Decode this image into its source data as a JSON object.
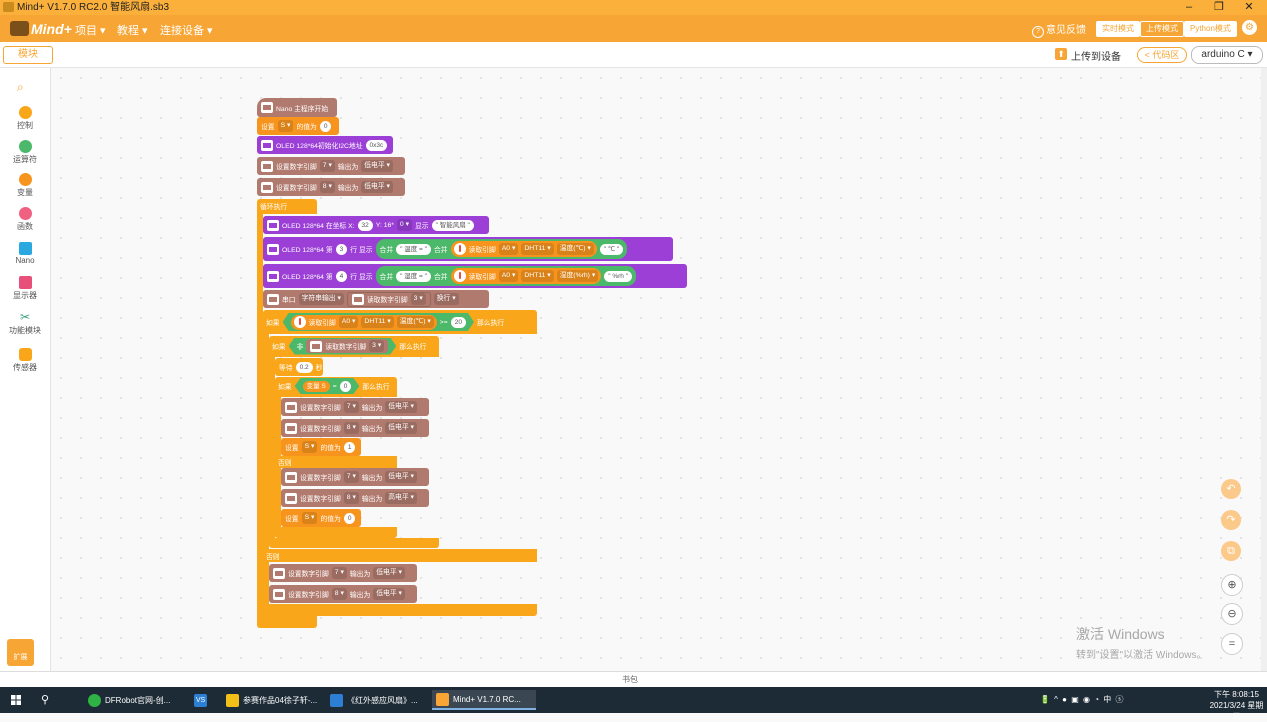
{
  "window": {
    "title": "Mind+ V1.7.0 RC2.0  智能风扇.sb3",
    "min": "–",
    "restore": "❐",
    "close": "✕"
  },
  "menubar": {
    "logo": "Mind+",
    "menus": [
      "项目 ▾",
      "教程 ▾",
      "连接设备 ▾"
    ],
    "feedback": "意见反馈",
    "modes": [
      "实时模式",
      "上传模式",
      "Python模式"
    ],
    "active_mode": "上传模式"
  },
  "toolbar": {
    "blocks_tab": "模块",
    "upload": "上传到设备",
    "code_area": "< 代码区",
    "board": "arduino C ▾"
  },
  "sidebar": {
    "categories": [
      {
        "label": "控制",
        "color": "#f9a61a"
      },
      {
        "label": "运算符",
        "color": "#4cb86a"
      },
      {
        "label": "变量",
        "color": "#f7941d"
      },
      {
        "label": "函数",
        "color": "#f06080"
      },
      {
        "label": "Nano",
        "color": "#2aa8e0"
      },
      {
        "label": "显示器",
        "color": "#e8507a"
      },
      {
        "label": "功能模块",
        "color": "#3aa07a"
      },
      {
        "label": "传感器",
        "color": "#f9a61a"
      }
    ],
    "extend_label": "扩展"
  },
  "script": {
    "hat": "Nano 主程序开始",
    "set_var": {
      "prefix": "设置",
      "var": "S ▾",
      "mid": "的值为",
      "val": "0"
    },
    "oled_init": {
      "text": "OLED 128*64初始化I2C地址",
      "addr": "0x3c"
    },
    "pin7_low": {
      "text": "设置数字引脚",
      "pin": "7 ▾",
      "mid": "输出为",
      "level": "低电平 ▾"
    },
    "pin8_low": {
      "text": "设置数字引脚",
      "pin": "8 ▾",
      "mid": "输出为",
      "level": "低电平 ▾"
    },
    "loop": "循环执行",
    "oled_xy": {
      "text": "OLED 128*64 在坐标 X:",
      "x": "32",
      "y_label": "Y: 16*",
      "y": "0 ▾",
      "show": "显示",
      "str": "\" 智能风扇 \""
    },
    "oled_row3": {
      "text": "OLED 128*64 第",
      "row": "3",
      "show": "行 显示",
      "join": "合并",
      "str1": "\" 温度 = \"",
      "join2": "合并",
      "read": "读取引脚",
      "pin": "A0 ▾",
      "sensor": "DHT11 ▾",
      "mode": "温度(℃) ▾",
      "unit": "\" ℃ \""
    },
    "oled_row4": {
      "text": "OLED 128*64 第",
      "row": "4",
      "show": "行 显示",
      "join": "合并",
      "str1": "\" 湿度 = \"",
      "join2": "合并",
      "read": "读取引脚",
      "pin": "A0 ▾",
      "sensor": "DHT11 ▾",
      "mode": "湿度(%rh) ▾",
      "unit": "\" %rh \""
    },
    "serial": {
      "text": "串口",
      "mode": "字符串输出 ▾",
      "read": "读取数字引脚",
      "pin": "3 ▾",
      "nl": "换行 ▾"
    },
    "if_temp": {
      "if": "如果",
      "read": "读取引脚",
      "pin": "A0 ▾",
      "sensor": "DHT11 ▾",
      "mode": "温度(℃) ▾",
      "op": ">=",
      "val": "20",
      "then": "那么执行"
    },
    "if_not": {
      "if": "如果",
      "not": "非",
      "read": "读取数字引脚",
      "pin": "3 ▾",
      "then": "那么执行"
    },
    "wait": {
      "text": "等待",
      "val": "0.2",
      "unit": "秒"
    },
    "if_s": {
      "if": "如果",
      "var": "变量 S",
      "op": "=",
      "val": "0",
      "then": "那么执行"
    },
    "inner1_pin7": {
      "text": "设置数字引脚",
      "pin": "7 ▾",
      "mid": "输出为",
      "level": "低电平 ▾"
    },
    "inner1_pin8": {
      "text": "设置数字引脚",
      "pin": "8 ▾",
      "mid": "输出为",
      "level": "低电平 ▾"
    },
    "set_s1": {
      "prefix": "设置",
      "var": "S ▾",
      "mid": "的值为",
      "val": "1"
    },
    "else1": "否则",
    "inner2_pin7": {
      "text": "设置数字引脚",
      "pin": "7 ▾",
      "mid": "输出为",
      "level": "低电平 ▾"
    },
    "inner2_pin8": {
      "text": "设置数字引脚",
      "pin": "8 ▾",
      "mid": "输出为",
      "level": "高电平 ▾"
    },
    "set_s0": {
      "prefix": "设置",
      "var": "S ▾",
      "mid": "的值为",
      "val": "0"
    },
    "else2": "否则",
    "outer_pin7": {
      "text": "设置数字引脚",
      "pin": "7 ▾",
      "mid": "输出为",
      "level": "低电平 ▾"
    },
    "outer_pin8": {
      "text": "设置数字引脚",
      "pin": "8 ▾",
      "mid": "输出为",
      "level": "低电平 ▾"
    }
  },
  "watermark": {
    "line1": "激活 Windows",
    "line2": "转到\"设置\"以激活 Windows。"
  },
  "bottom_bar": "书包",
  "taskbar": {
    "tasks": [
      {
        "label": "DFRobot官网-创...",
        "color": "#2fb344"
      },
      {
        "label": "",
        "color": "#2d7fd3",
        "glyph": "VS"
      },
      {
        "label": "参赛作品04徐子轩-...",
        "color": "#f2c018"
      },
      {
        "label": "《红外感应风扇》...",
        "color": "#2d7fd3"
      },
      {
        "label": "Mind+ V1.7.0 RC...",
        "color": "#f7a534"
      }
    ],
    "tray": "🔋 ^ ● ▣ ◉ ◔ 中 ⓢ",
    "time": "下午 8:08:15",
    "date": "2021/3/24 星期三"
  }
}
